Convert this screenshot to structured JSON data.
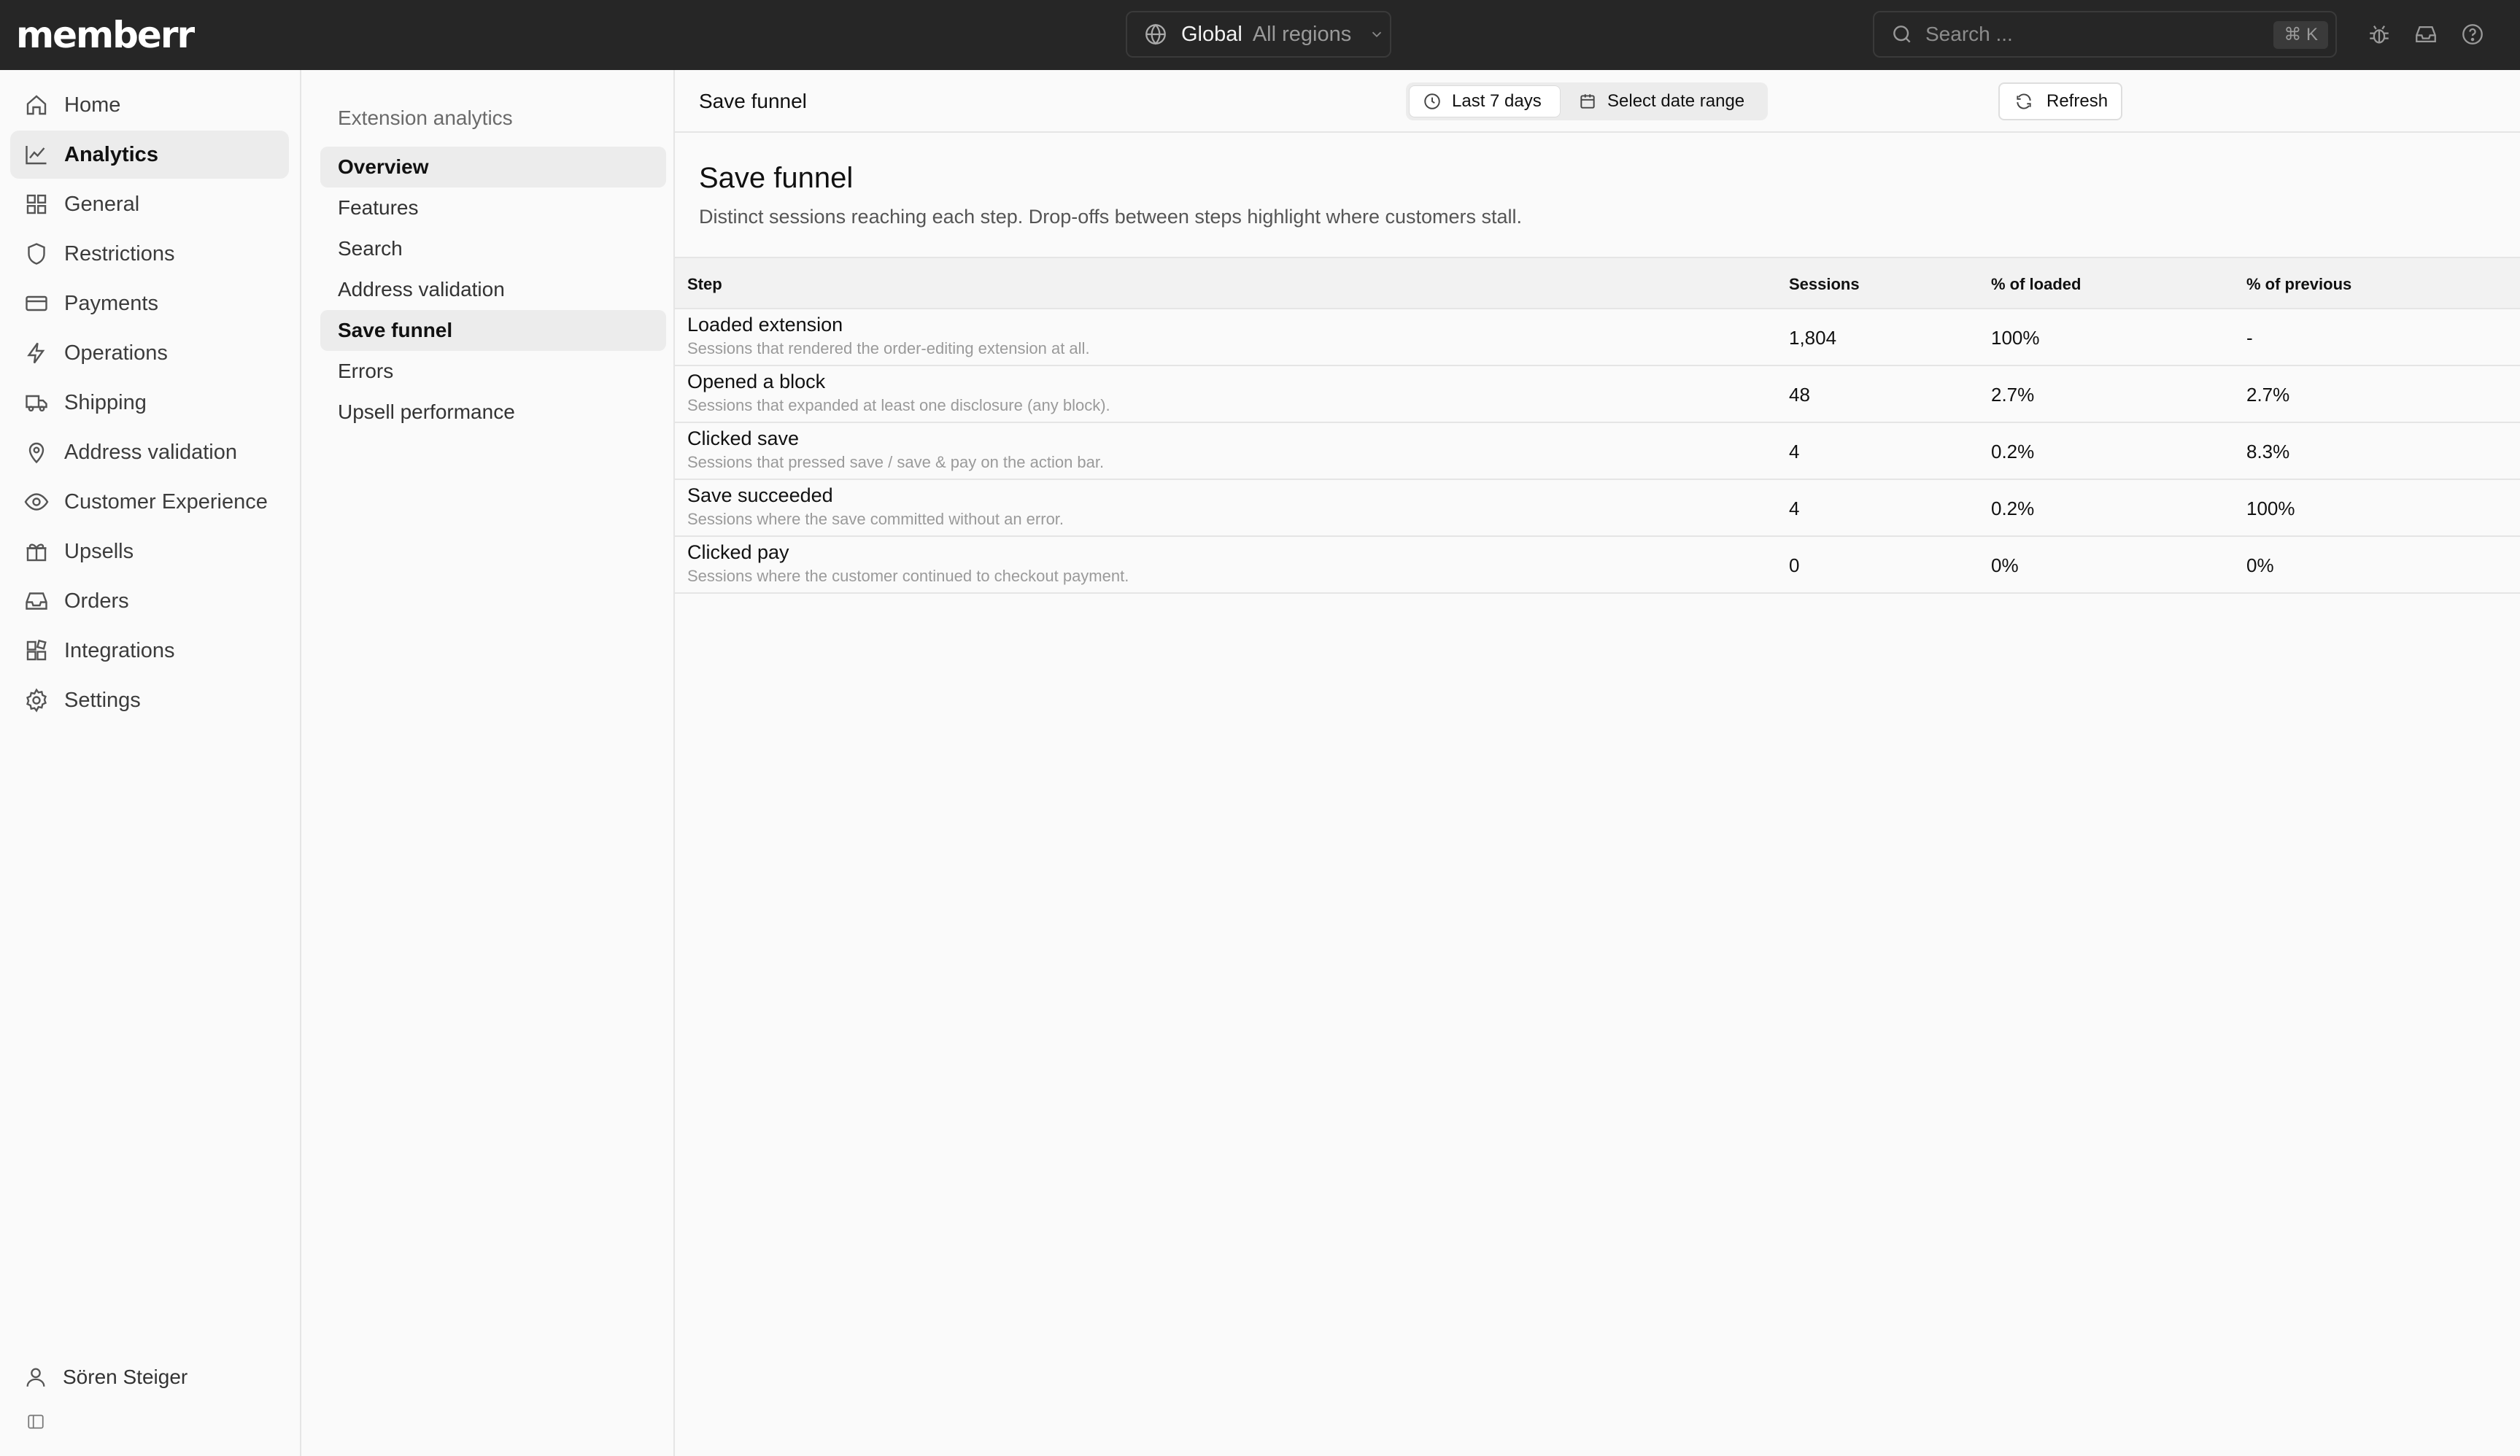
{
  "app": {
    "logo": "memberr"
  },
  "topbar": {
    "region_scope": "Global",
    "region_value": "All regions",
    "search_placeholder": "Search ...",
    "search_shortcut": "⌘ K"
  },
  "sidebar": {
    "items": [
      {
        "label": "Home",
        "icon": "home-icon"
      },
      {
        "label": "Analytics",
        "icon": "chart-icon",
        "active": true
      },
      {
        "label": "General",
        "icon": "grid-icon"
      },
      {
        "label": "Restrictions",
        "icon": "shield-icon"
      },
      {
        "label": "Payments",
        "icon": "credit-card-icon"
      },
      {
        "label": "Operations",
        "icon": "bolt-icon"
      },
      {
        "label": "Shipping",
        "icon": "truck-icon"
      },
      {
        "label": "Address validation",
        "icon": "map-pin-icon"
      },
      {
        "label": "Customer Experience",
        "icon": "eye-icon"
      },
      {
        "label": "Upsells",
        "icon": "gift-icon"
      },
      {
        "label": "Orders",
        "icon": "inbox-icon"
      },
      {
        "label": "Integrations",
        "icon": "puzzle-icon"
      },
      {
        "label": "Settings",
        "icon": "gear-icon"
      }
    ],
    "user_name": "Sören Steiger"
  },
  "subnav": {
    "title": "Extension analytics",
    "items": [
      {
        "label": "Overview"
      },
      {
        "label": "Features"
      },
      {
        "label": "Search"
      },
      {
        "label": "Address validation"
      },
      {
        "label": "Save funnel",
        "active": true
      },
      {
        "label": "Errors"
      },
      {
        "label": "Upsell performance"
      }
    ]
  },
  "header": {
    "breadcrumb": "Save funnel",
    "refresh_label": "Refresh",
    "range_label": "Last 7 days",
    "custom_range_label": "Select date range"
  },
  "page": {
    "title": "Save funnel",
    "description": "Distinct sessions reaching each step. Drop-offs between steps highlight where customers stall."
  },
  "table": {
    "columns": [
      "Step",
      "Sessions",
      "% of loaded",
      "% of previous"
    ],
    "rows": [
      {
        "step": "Loaded extension",
        "desc": "Sessions that rendered the order-editing extension at all.",
        "sessions": "1,804",
        "pct_loaded": "100%",
        "pct_prev": "-"
      },
      {
        "step": "Opened a block",
        "desc": "Sessions that expanded at least one disclosure (any block).",
        "sessions": "48",
        "pct_loaded": "2.7%",
        "pct_prev": "2.7%"
      },
      {
        "step": "Clicked save",
        "desc": "Sessions that pressed save / save & pay on the action bar.",
        "sessions": "4",
        "pct_loaded": "0.2%",
        "pct_prev": "8.3%"
      },
      {
        "step": "Save succeeded",
        "desc": "Sessions where the save committed without an error.",
        "sessions": "4",
        "pct_loaded": "0.2%",
        "pct_prev": "100%"
      },
      {
        "step": "Clicked pay",
        "desc": "Sessions where the customer continued to checkout payment.",
        "sessions": "0",
        "pct_loaded": "0%",
        "pct_prev": "0%"
      }
    ]
  }
}
